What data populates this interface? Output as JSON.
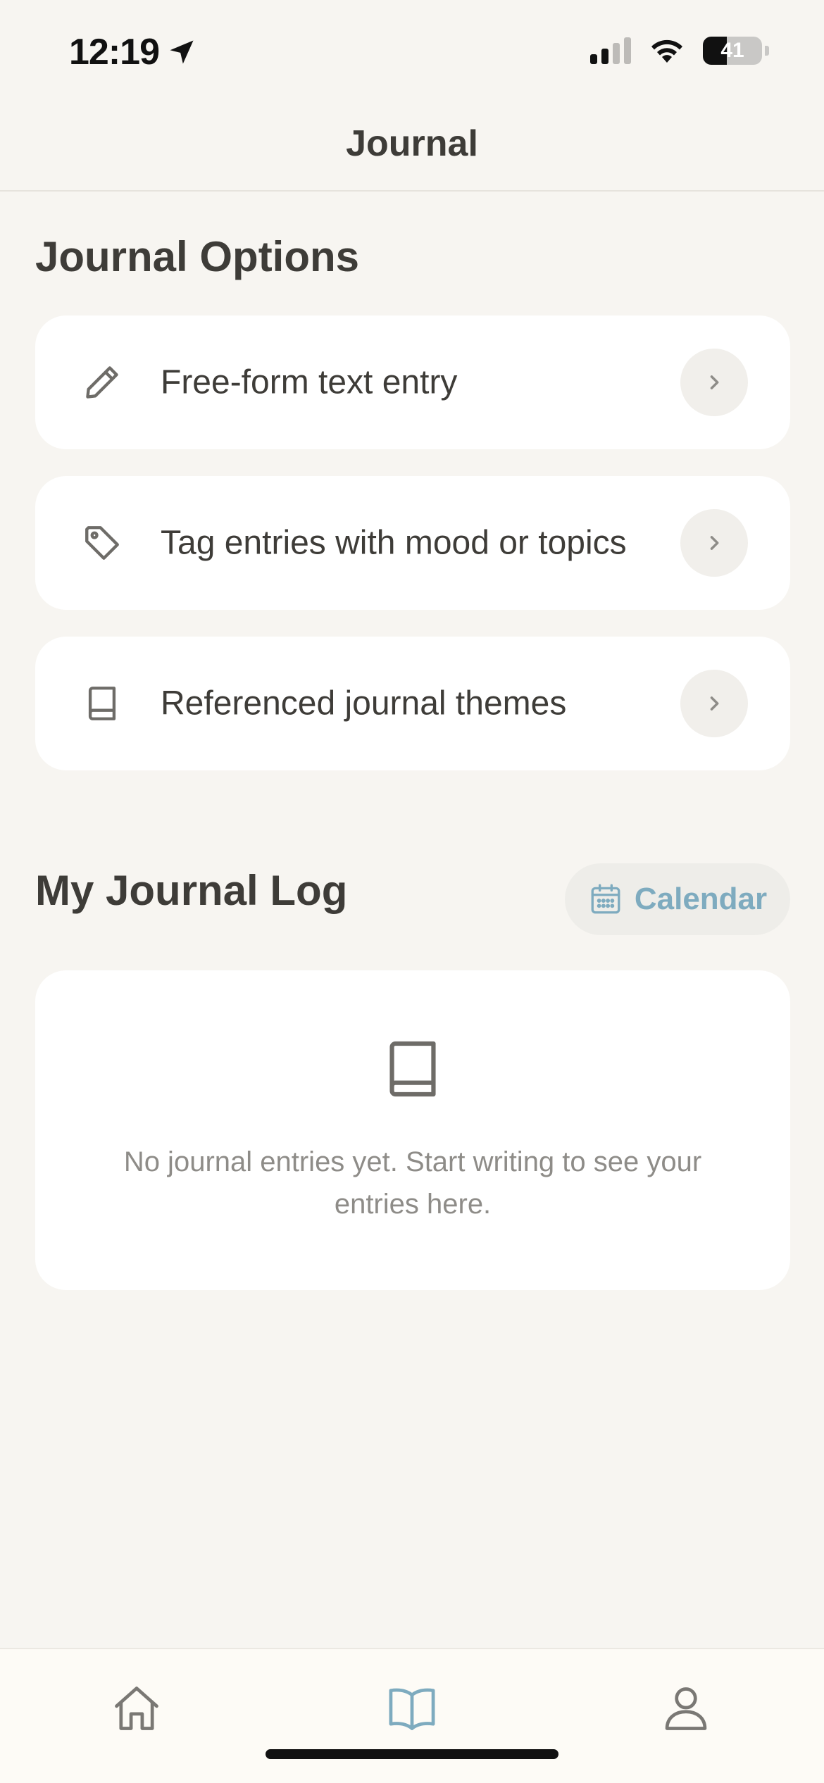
{
  "status_bar": {
    "time": "12:19",
    "battery": "41",
    "battery_level": 0.41
  },
  "header": {
    "title": "Journal"
  },
  "journal_options": {
    "title": "Journal Options",
    "items": [
      {
        "label": "Free-form text entry",
        "icon": "pencil-icon"
      },
      {
        "label": "Tag entries with mood or topics",
        "icon": "tag-icon"
      },
      {
        "label": "Referenced journal themes",
        "icon": "book-icon"
      }
    ]
  },
  "journal_log": {
    "title": "My Journal Log",
    "calendar_label": "Calendar",
    "empty_text": "No journal entries yet. Start writing to see your entries here."
  },
  "tab_bar": {
    "tabs": [
      {
        "icon": "home-icon",
        "active": false
      },
      {
        "icon": "open-book-icon",
        "active": true
      },
      {
        "icon": "person-icon",
        "active": false
      }
    ]
  },
  "colors": {
    "background": "#f7f5f1",
    "card": "#ffffff",
    "text": "#3e3c38",
    "muted_text": "#8e8c88",
    "accent": "#7eabbf"
  }
}
